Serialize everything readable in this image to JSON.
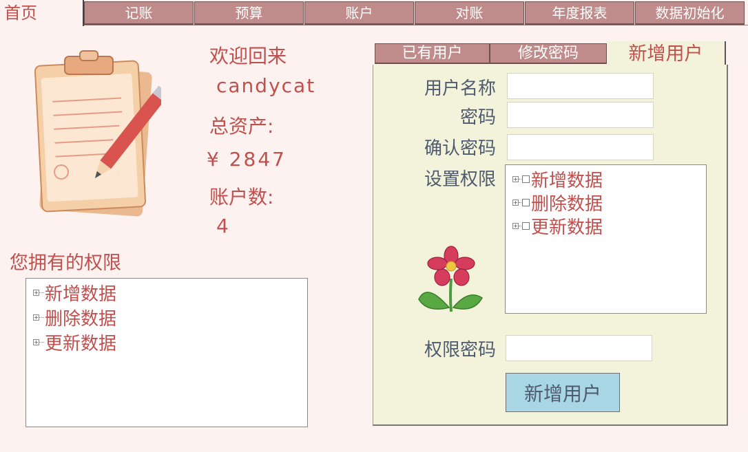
{
  "nav": {
    "tabs": [
      "首页",
      "记账",
      "预算",
      "账户",
      "对账",
      "年度报表",
      "数据初始化"
    ],
    "active": "首页"
  },
  "welcome": {
    "greeting": "欢迎回来",
    "username": "candycat",
    "total_assets_label": "总资产:",
    "total_assets_value": "¥ 2847",
    "account_count_label": "账户数:",
    "account_count_value": "4"
  },
  "my_permissions": {
    "title": "您拥有的权限",
    "items": [
      "新增数据",
      "删除数据",
      "更新数据"
    ]
  },
  "user_panel": {
    "tabs": [
      "已有用户",
      "修改密码",
      "新增用户"
    ],
    "active_tab": "新增用户",
    "form": {
      "username_label": "用户名称",
      "username_value": "",
      "password_label": "密码",
      "password_value": "",
      "confirm_label": "确认密码",
      "confirm_value": "",
      "permissions_label": "设置权限",
      "permissions": [
        "新增数据",
        "删除数据",
        "更新数据"
      ],
      "permission_password_label": "权限密码",
      "permission_password_value": "",
      "submit_label": "新增用户"
    }
  },
  "colors": {
    "background": "#fdf2ef",
    "tab_inactive": "#c08c8b",
    "accent_text": "#c0504d",
    "label_text": "#4e5b6e",
    "panel_bg": "#f3f3dc",
    "button_bg": "#a9d6e5"
  }
}
